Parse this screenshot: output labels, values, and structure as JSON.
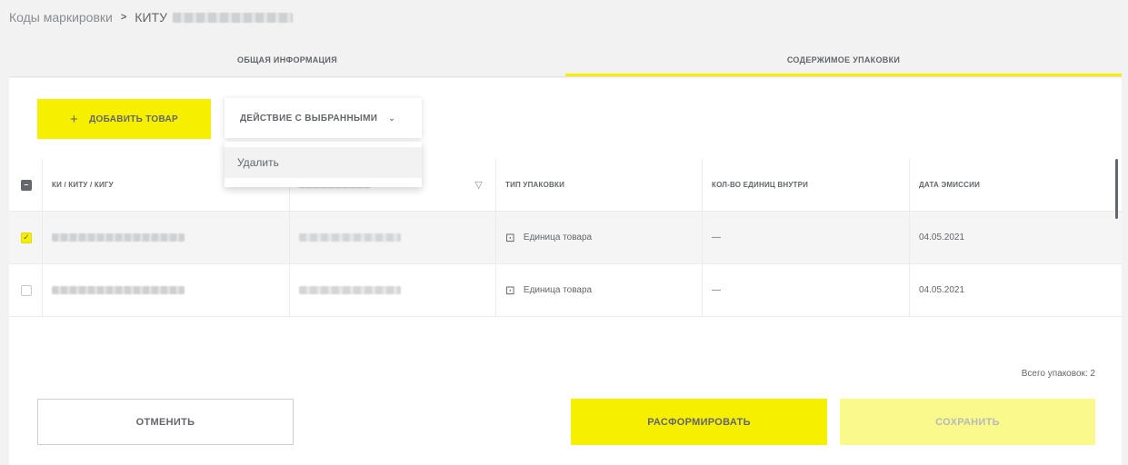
{
  "breadcrumb": {
    "root": "Коды маркировки",
    "separator": ">",
    "current": "КИТУ"
  },
  "tabs": [
    {
      "label": "ОБЩАЯ ИНФОРМАЦИЯ",
      "active": false
    },
    {
      "label": "СОДЕРЖИМОЕ УПАКОВКИ",
      "active": true
    }
  ],
  "toolbar": {
    "add_plus": "+",
    "add_label": "ДОБАВИТЬ ТОВАР",
    "action_label": "ДЕЙСТВИЕ С ВЫБРАННЫМИ",
    "action_chevron": "⌄",
    "menu_items": [
      "Удалить"
    ]
  },
  "table": {
    "headers": {
      "code": "КИ / КИТУ / КИГУ",
      "package_type": "ТИП УПАКОВКИ",
      "units_inside": "КОЛ-ВО ЕДИНИЦ ВНУТРИ",
      "emission_date": "ДАТА ЭМИССИИ"
    },
    "rows": [
      {
        "checked": true,
        "package_type": "Единица товара",
        "units_inside": "—",
        "emission_date": "04.05.2021"
      },
      {
        "checked": false,
        "package_type": "Единица товара",
        "units_inside": "—",
        "emission_date": "04.05.2021"
      }
    ]
  },
  "summary": {
    "total_label": "Всего упаковок: 2"
  },
  "footer": {
    "cancel_label": "ОТМЕНИТЬ",
    "disband_label": "РАСФОРМИРОВАТЬ",
    "save_label": "СОХРАНИТЬ"
  },
  "colors": {
    "accent": "#f6f000",
    "accent_disabled": "#fafa8c",
    "text": "#63666a"
  },
  "icons": {
    "checkbox_header": "minus-checkbox-icon",
    "package": "package-icon",
    "filter": "filter-icon",
    "chevron": "chevron-down-icon"
  }
}
